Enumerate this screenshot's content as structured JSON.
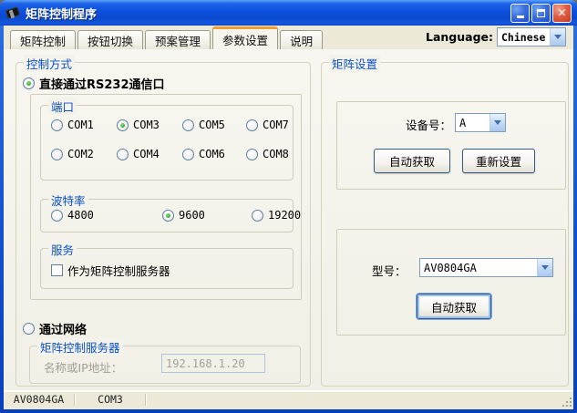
{
  "window": {
    "title": "矩阵控制程序"
  },
  "tabs": {
    "items": [
      {
        "label": "矩阵控制",
        "active": false
      },
      {
        "label": "按钮切换",
        "active": false
      },
      {
        "label": "预案管理",
        "active": false
      },
      {
        "label": "参数设置",
        "active": true
      },
      {
        "label": "说明",
        "active": false
      }
    ],
    "language_label": "Language:",
    "language_value": "Chinese"
  },
  "control_mode_group": {
    "title": "控制方式",
    "rs232_radio": {
      "label": "直接通过RS232通信口",
      "selected": true
    },
    "port_group": {
      "title": "端口",
      "options": [
        "COM1",
        "COM3",
        "COM5",
        "COM7",
        "COM2",
        "COM4",
        "COM6",
        "COM8"
      ],
      "selected": "COM3"
    },
    "baud_group": {
      "title": "波特率",
      "options": [
        "4800",
        "9600",
        "19200"
      ],
      "selected": "9600"
    },
    "service_group": {
      "title": "服务",
      "checkbox_label": "作为矩阵控制服务器",
      "checked": false
    },
    "network_radio": {
      "label": "通过网络",
      "selected": false
    },
    "server_group": {
      "title": "矩阵控制服务器",
      "ip_label": "名称或IP地址：",
      "ip_value": "192.168.1.20",
      "enabled": false
    }
  },
  "matrix_group": {
    "title": "矩阵设置",
    "device_box": {
      "label": "设备号：",
      "value": "A",
      "buttons": [
        "自动获取",
        "重新设置"
      ]
    },
    "model_box": {
      "label": "型号：",
      "value": "AV0804GA",
      "button": "自动获取"
    }
  },
  "status_bar": {
    "panes": [
      "AV0804GA",
      "COM3"
    ]
  },
  "colors": {
    "titlebar_blue": "#0D51DE",
    "active_tab_accent": "#EF9F33",
    "group_label_blue": "#0B50C8",
    "radio_selected_green": "#3CAC38",
    "close_button_red": "#E25D43",
    "dialog_bg": "#ECE9D8"
  }
}
